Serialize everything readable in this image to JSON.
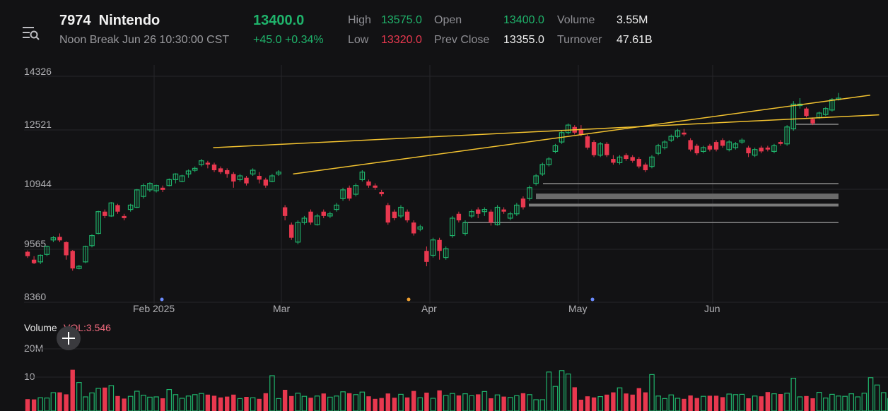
{
  "header": {
    "symbol": "7974",
    "name": "Nintendo",
    "status": "Noon Break Jun 26 10:30:00 CST",
    "price": "13400.0",
    "change": "+45.0",
    "change_pct": "+0.34%",
    "stats": {
      "high_label": "High",
      "high": "13575.0",
      "low_label": "Low",
      "low": "13320.0",
      "open_label": "Open",
      "open": "13400.0",
      "prev_close_label": "Prev Close",
      "prev_close": "13355.0",
      "volume_label": "Volume",
      "volume": "3.55M",
      "turnover_label": "Turnover",
      "turnover": "47.61B"
    }
  },
  "menu_icon": "list-search-icon",
  "crosshair_icon": "plus-icon",
  "colors": {
    "up": "#1fb36b",
    "down": "#e8384f",
    "trend": "#f2c230",
    "grid": "#26262a",
    "level": "#8a8a8a"
  },
  "chart_data": {
    "type": "candlestick",
    "y_ticks": [
      "14326",
      "12521",
      "10944",
      "9565",
      "8360"
    ],
    "x_ticks": [
      "Feb 2025",
      "Mar",
      "Apr",
      "May",
      "Jun"
    ],
    "ylim": [
      8360,
      14326
    ],
    "volume": {
      "title": "Volume",
      "indicator": "VOL:3.546",
      "y_ticks": [
        "20M",
        "10"
      ]
    },
    "candles": [
      [
        9380,
        9280,
        9410,
        9240
      ],
      [
        9200,
        9120,
        9280,
        9100
      ],
      [
        9150,
        9300,
        9320,
        9100
      ],
      [
        9320,
        9500,
        9520,
        9280
      ],
      [
        9650,
        9700,
        9740,
        9600
      ],
      [
        9720,
        9640,
        9800,
        9600
      ],
      [
        9600,
        9300,
        9620,
        9200
      ],
      [
        9400,
        9000,
        9420,
        8950
      ],
      [
        9000,
        9050,
        9080,
        8980
      ],
      [
        9150,
        9500,
        9520,
        9120
      ],
      [
        9520,
        9750,
        9780,
        9480
      ],
      [
        9800,
        10300,
        10320,
        9780
      ],
      [
        10300,
        10200,
        10350,
        10150
      ],
      [
        10200,
        10500,
        10520,
        10180
      ],
      [
        10450,
        10300,
        10480,
        10250
      ],
      [
        10200,
        10150,
        10250,
        10100
      ],
      [
        10350,
        10450,
        10480,
        10300
      ],
      [
        10400,
        10800,
        10820,
        10380
      ],
      [
        10650,
        10900,
        10950,
        10600
      ],
      [
        10800,
        10950,
        10980,
        10750
      ],
      [
        10780,
        10900,
        10920,
        10740
      ],
      [
        10850,
        10800,
        10900,
        10750
      ],
      [
        10900,
        11050,
        11080,
        10880
      ],
      [
        11050,
        11200,
        11220,
        10950
      ],
      [
        11000,
        11150,
        11180,
        10980
      ],
      [
        11200,
        11280,
        11320,
        11100
      ],
      [
        11300,
        11350,
        11400,
        11250
      ],
      [
        11450,
        11550,
        11600,
        11400
      ],
      [
        11500,
        11450,
        11550,
        11350
      ],
      [
        11450,
        11300,
        11500,
        11250
      ],
      [
        11350,
        11250,
        11400,
        11200
      ],
      [
        11300,
        11200,
        11350,
        11100
      ],
      [
        11200,
        11000,
        11250,
        10850
      ],
      [
        11050,
        11150,
        11200,
        11000
      ],
      [
        11100,
        10950,
        11150,
        10900
      ],
      [
        11200,
        11300,
        11350,
        11150
      ],
      [
        11150,
        11050,
        11250,
        10950
      ],
      [
        11050,
        10900,
        11100,
        10850
      ],
      [
        11000,
        11150,
        11200,
        10980
      ],
      [
        11200,
        11250,
        11300,
        11150
      ],
      [
        10400,
        10200,
        10450,
        10100
      ],
      [
        10000,
        9700,
        10050,
        9650
      ],
      [
        9600,
        10050,
        10100,
        9550
      ],
      [
        10050,
        10150,
        10200,
        10000
      ],
      [
        10300,
        10050,
        10350,
        10000
      ],
      [
        10000,
        10200,
        10250,
        9980
      ],
      [
        10300,
        10200,
        10350,
        10150
      ],
      [
        10200,
        10250,
        10300,
        10150
      ],
      [
        10350,
        10450,
        10500,
        10300
      ],
      [
        10600,
        10800,
        10850,
        10550
      ],
      [
        10850,
        10600,
        10900,
        10550
      ],
      [
        10700,
        10900,
        10950,
        10650
      ],
      [
        11050,
        11250,
        11300,
        11000
      ],
      [
        11000,
        10900,
        11050,
        10850
      ],
      [
        10900,
        10850,
        10950,
        10800
      ],
      [
        10750,
        10700,
        10800,
        10650
      ],
      [
        10450,
        10050,
        10500,
        10000
      ],
      [
        10300,
        10150,
        10350,
        10100
      ],
      [
        10200,
        10400,
        10450,
        10150
      ],
      [
        10300,
        10100,
        10350,
        10050
      ],
      [
        10050,
        9800,
        10100,
        9750
      ],
      [
        9900,
        9950,
        10000,
        9850
      ],
      [
        9400,
        9150,
        9500,
        9050
      ],
      [
        9300,
        9650,
        9700,
        9250
      ],
      [
        9650,
        9400,
        9700,
        9200
      ],
      [
        9250,
        9450,
        9500,
        9200
      ],
      [
        9750,
        10150,
        10200,
        9700
      ],
      [
        10250,
        10100,
        10300,
        10050
      ],
      [
        9800,
        10050,
        10100,
        9750
      ],
      [
        10200,
        10300,
        10350,
        10150
      ],
      [
        10350,
        10250,
        10400,
        10150
      ],
      [
        10300,
        10350,
        10400,
        10200
      ],
      [
        10300,
        10050,
        10350,
        9980
      ],
      [
        10000,
        10400,
        10450,
        9980
      ],
      [
        10350,
        10300,
        10400,
        10250
      ],
      [
        10150,
        10250,
        10300,
        10100
      ],
      [
        10250,
        10450,
        10500,
        10200
      ],
      [
        10600,
        10400,
        10650,
        10350
      ],
      [
        10600,
        10850,
        10900,
        10550
      ],
      [
        10950,
        11150,
        11200,
        10900
      ],
      [
        11200,
        11450,
        11500,
        11150
      ],
      [
        11450,
        11600,
        11650,
        11400
      ],
      [
        11800,
        11950,
        12000,
        11750
      ],
      [
        12050,
        12300,
        12350,
        12000
      ],
      [
        12300,
        12500,
        12550,
        12250
      ],
      [
        12450,
        12300,
        12500,
        12250
      ],
      [
        12400,
        12250,
        12500,
        12200
      ],
      [
        12200,
        11900,
        12250,
        11850
      ],
      [
        12050,
        11700,
        12100,
        11650
      ],
      [
        11700,
        12000,
        12050,
        11650
      ],
      [
        12000,
        11700,
        12050,
        11650
      ],
      [
        11600,
        11500,
        11700,
        11450
      ],
      [
        11500,
        11650,
        11700,
        11450
      ],
      [
        11700,
        11600,
        11750,
        11550
      ],
      [
        11650,
        11550,
        11700,
        11500
      ],
      [
        11600,
        11400,
        11650,
        11350
      ],
      [
        11450,
        11300,
        11500,
        11250
      ],
      [
        11400,
        11650,
        11700,
        11350
      ],
      [
        11750,
        11950,
        12000,
        11700
      ],
      [
        11900,
        12050,
        12100,
        11850
      ],
      [
        12100,
        12200,
        12250,
        12050
      ],
      [
        12200,
        12350,
        12400,
        12150
      ],
      [
        12300,
        12250,
        12400,
        12200
      ],
      [
        12100,
        11850,
        12150,
        11800
      ],
      [
        11950,
        11750,
        12000,
        11700
      ],
      [
        11800,
        11900,
        11950,
        11750
      ],
      [
        11950,
        11850,
        12000,
        11800
      ],
      [
        12050,
        11850,
        12100,
        11800
      ],
      [
        12100,
        11950,
        12150,
        11900
      ],
      [
        11850,
        12050,
        12100,
        11800
      ],
      [
        11900,
        12000,
        12050,
        11850
      ],
      [
        12050,
        12100,
        12150,
        12000
      ],
      [
        11900,
        11750,
        11950,
        11650
      ],
      [
        11700,
        11850,
        11900,
        11650
      ],
      [
        11900,
        11800,
        11950,
        11750
      ],
      [
        11900,
        11850,
        11950,
        11800
      ],
      [
        11800,
        11950,
        12000,
        11750
      ],
      [
        12050,
        12000,
        12100,
        11950
      ],
      [
        12000,
        12450,
        12500,
        11950
      ],
      [
        12400,
        13200,
        13300,
        12350
      ],
      [
        13150,
        13200,
        13400,
        13050
      ],
      [
        13050,
        12800,
        13100,
        12750
      ],
      [
        12700,
        12550,
        12750,
        12500
      ],
      [
        12750,
        12900,
        12950,
        12700
      ],
      [
        12850,
        13050,
        13100,
        12800
      ],
      [
        13000,
        13350,
        13400,
        12950
      ],
      [
        13355,
        13400,
        13575,
        13320
      ]
    ],
    "volumes": [
      4.2,
      4.1,
      4.7,
      4.6,
      6.5,
      6.6,
      5.9,
      14.6,
      10.1,
      5.0,
      6.4,
      8.0,
      8.3,
      9.0,
      5.3,
      4.4,
      5.2,
      7.0,
      5.6,
      4.9,
      5.0,
      4.5,
      7.6,
      5.8,
      4.5,
      5.3,
      5.8,
      6.2,
      5.8,
      5.4,
      4.8,
      5.1,
      5.8,
      4.4,
      5.0,
      4.7,
      4.3,
      6.3,
      12.5,
      4.4,
      7.5,
      5.3,
      6.3,
      5.2,
      4.7,
      5.3,
      6.2,
      4.9,
      5.3,
      6.8,
      6.3,
      5.8,
      6.7,
      5.2,
      4.3,
      4.6,
      6.2,
      4.7,
      5.9,
      4.8,
      7.1,
      4.7,
      6.5,
      4.5,
      7.3,
      5.5,
      6.2,
      5.5,
      6.1,
      5.4,
      5.9,
      6.9,
      4.5,
      5.7,
      5.1,
      4.8,
      5.4,
      6.3,
      5.8,
      4.0,
      4.0,
      13.8,
      8.7,
      14.3,
      13.1,
      8.4,
      4.0,
      5.2,
      4.8,
      5.1,
      5.8,
      6.6,
      8.2,
      6.2,
      5.8,
      8.1,
      6.6,
      12.9,
      5.3,
      4.4,
      5.7,
      4.5,
      4.3,
      5.5,
      4.6,
      5.2,
      5.4,
      5.4,
      4.9,
      6.0,
      5.8,
      5.9,
      4.5,
      5.3,
      5.2,
      6.7,
      6.1,
      6.0,
      6.3,
      11.6,
      5.0,
      5.3,
      4.5,
      6.6,
      4.6,
      5.9,
      5.3,
      5.2,
      6.1,
      5.0,
      6.3,
      11.8,
      9.2,
      6.5,
      4.4,
      7.6,
      5.3
    ],
    "levels": [
      10944,
      10650,
      10450,
      10050,
      12521
    ],
    "trendlines": [
      {
        "from": [
          11900,
          0.24
        ],
        "to": [
          12840,
          0.99
        ]
      },
      {
        "from": [
          11200,
          0.33
        ],
        "to": [
          13500,
          0.98
        ]
      }
    ]
  }
}
